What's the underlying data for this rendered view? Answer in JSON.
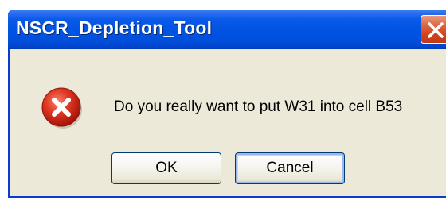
{
  "dialog": {
    "title": "NSCR_Depletion_Tool",
    "message": "Do you really want to put W31 into cell B53",
    "icon": "error-icon",
    "buttons": {
      "ok_label": "OK",
      "cancel_label": "Cancel"
    },
    "close_icon": "close-icon"
  },
  "colors": {
    "titlebar": "#0054e3",
    "window_body": "#ece9d8",
    "close_button": "#d0421d",
    "error_icon": "#d5291a"
  }
}
